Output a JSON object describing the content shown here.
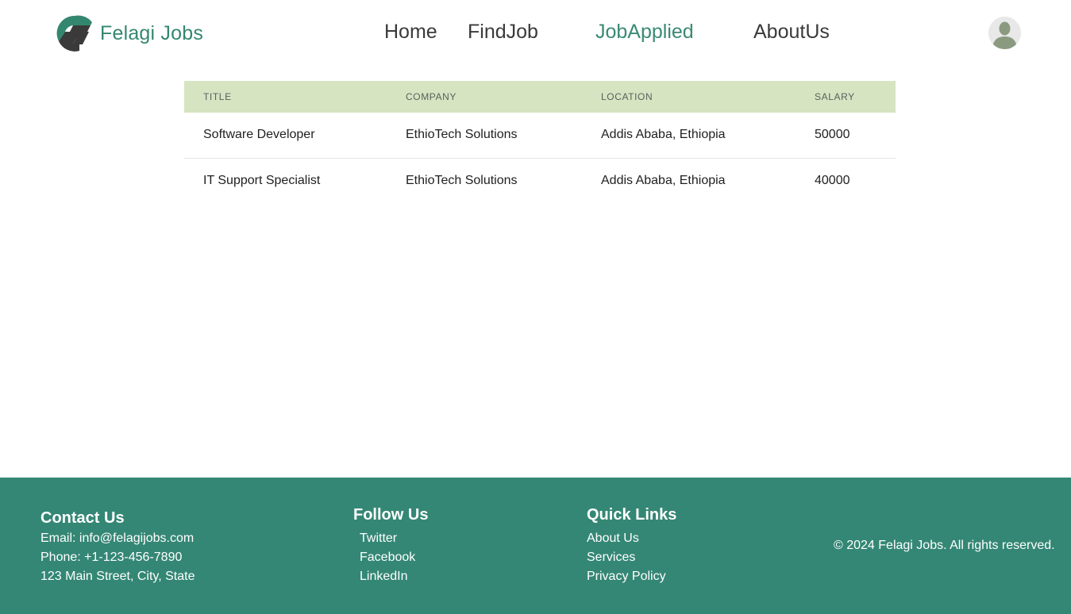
{
  "header": {
    "brand_name": "Felagi Jobs",
    "nav": [
      {
        "label": "Home"
      },
      {
        "label": "FindJob"
      },
      {
        "label": "JobApplied"
      },
      {
        "label": "AboutUs"
      }
    ],
    "active_nav": "JobApplied"
  },
  "table": {
    "headers": [
      "TITLE",
      "COMPANY",
      "LOCATION",
      "SALARY"
    ],
    "rows": [
      {
        "title": "Software Developer",
        "company": "EthioTech Solutions",
        "location": "Addis Ababa, Ethiopia",
        "salary": "50000"
      },
      {
        "title": "IT Support Specialist",
        "company": "EthioTech Solutions",
        "location": "Addis Ababa, Ethiopia",
        "salary": "40000"
      }
    ]
  },
  "footer": {
    "contact": {
      "heading": "Contact Us",
      "email": "Email: info@felagijobs.com",
      "phone": "Phone: +1-123-456-7890",
      "address": "123 Main Street, City, State"
    },
    "follow": {
      "heading": "Follow Us",
      "links": [
        "Twitter",
        "Facebook",
        "LinkedIn"
      ]
    },
    "quick_links": {
      "heading": "Quick Links",
      "links": [
        "About Us",
        "Services",
        "Privacy Policy"
      ]
    },
    "copyright": "© 2024 Felagi Jobs. All rights reserved."
  },
  "colors": {
    "brand_green": "#34876f",
    "table_header_bg": "#d6e4c2",
    "footer_bg": "#348775"
  },
  "icons": {
    "logo": "felagi-f-logo-icon",
    "avatar": "user-silhouette-icon"
  }
}
